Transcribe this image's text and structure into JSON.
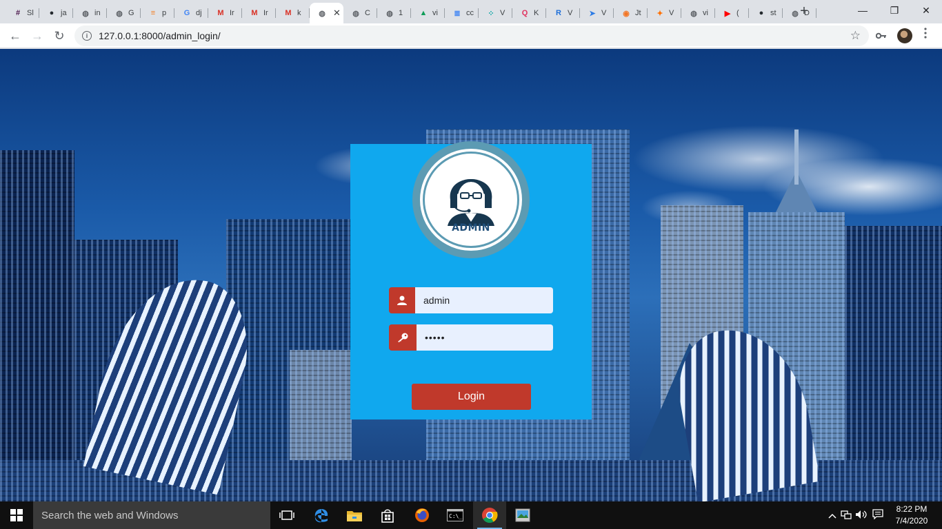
{
  "browser": {
    "tabs": [
      {
        "label": "Sl",
        "icon": "slack-icon",
        "color": "#4a154b"
      },
      {
        "label": "ja",
        "icon": "github-icon",
        "color": "#24292e"
      },
      {
        "label": "in",
        "icon": "globe-icon",
        "color": "#5f6368"
      },
      {
        "label": "G",
        "icon": "globe-icon",
        "color": "#5f6368"
      },
      {
        "label": "p",
        "icon": "stackoverflow-icon",
        "color": "#f48024"
      },
      {
        "label": "dj",
        "icon": "google-icon",
        "color": "#4285f4"
      },
      {
        "label": "Ir",
        "icon": "gmail-icon",
        "color": "#d93025"
      },
      {
        "label": "Ir",
        "icon": "gmail-icon",
        "color": "#d93025"
      },
      {
        "label": "k",
        "icon": "gmail-icon",
        "color": "#d93025"
      },
      {
        "label": "",
        "icon": "globe-icon",
        "color": "#5f6368",
        "active": true
      },
      {
        "label": "C",
        "icon": "globe-icon",
        "color": "#5f6368"
      },
      {
        "label": "1",
        "icon": "globe-icon",
        "color": "#5f6368"
      },
      {
        "label": "vi",
        "icon": "drive-icon",
        "color": "#0f9d58"
      },
      {
        "label": "cc",
        "icon": "docs-icon",
        "color": "#4285f4"
      },
      {
        "label": "V",
        "icon": "dots-icon",
        "color": "#00a3a3"
      },
      {
        "label": "K",
        "icon": "quora-icon",
        "color": "#e0325f"
      },
      {
        "label": "V",
        "icon": "r-icon",
        "color": "#1e6fd9"
      },
      {
        "label": "V",
        "icon": "send-icon",
        "color": "#2c7be5"
      },
      {
        "label": "Jt",
        "icon": "jupyter-icon",
        "color": "#f37626"
      },
      {
        "label": "V",
        "icon": "runner-icon",
        "color": "#ff6f00"
      },
      {
        "label": "vi",
        "icon": "globe-icon",
        "color": "#5f6368"
      },
      {
        "label": "(",
        "icon": "youtube-icon",
        "color": "#ff0000"
      },
      {
        "label": "st",
        "icon": "github-icon",
        "color": "#24292e"
      },
      {
        "label": "D",
        "icon": "globe-icon",
        "color": "#5f6368"
      }
    ],
    "close_glyph": "✕",
    "new_tab_glyph": "+",
    "url": "127.0.0.1:8000/admin_login/",
    "info_glyph": "i",
    "star_glyph": "☆",
    "back_glyph": "←",
    "forward_glyph": "→",
    "reload_glyph": "↻",
    "minimize_glyph": "—",
    "restore_glyph": "❐",
    "window_close_glyph": "✕"
  },
  "login": {
    "admin_caption": "ADMIN",
    "username_value": "admin",
    "password_value": "•••••",
    "login_label": "Login",
    "accent_color": "#c0392b",
    "card_color": "#10a8ee"
  },
  "taskbar": {
    "search_placeholder": "Search the web and Windows",
    "time": "8:22 PM",
    "date": "7/4/2020"
  }
}
